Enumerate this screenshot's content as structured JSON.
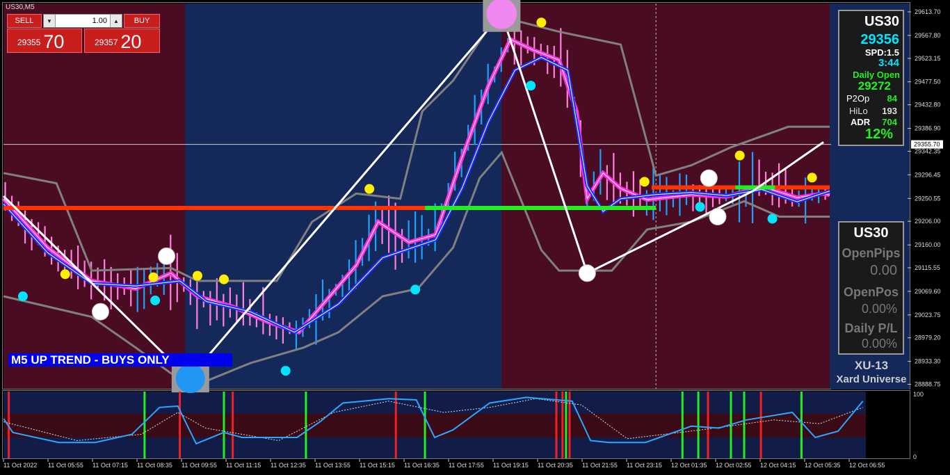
{
  "window": {
    "symbol_label": "US30,M5"
  },
  "trade_panel": {
    "sell_label": "SELL",
    "buy_label": "BUY",
    "lot_value": "1.00",
    "bid_small": "29355",
    "bid_big": "70",
    "ask_small": "29357",
    "ask_big": "20"
  },
  "info_box": {
    "symbol": "US30",
    "price": "29356",
    "spread": "SPD:1.5",
    "timer": "3:44",
    "daily_open_label": "Daily Open",
    "daily_open": "29272",
    "p2op_label": "P2Op",
    "p2op": "84",
    "hilo_label": "HiLo",
    "hilo": "193",
    "adr_label": "ADR",
    "adr": "704",
    "adr_pct": "12%"
  },
  "stats_box": {
    "symbol": "US30",
    "open_pips_label": "OpenPips",
    "open_pips": "0.00",
    "open_pos_label": "OpenPos",
    "open_pos": "0.00%",
    "daily_pl_label": "Daily P/L",
    "daily_pl": "0.00%"
  },
  "branding": {
    "title": "XU-13",
    "subtitle": "Xard Universe"
  },
  "trend_label": "M5 UP TREND - BUYS ONLY",
  "colors": {
    "maroon_zone": "#4a0c22",
    "blue_zone": "#14295a",
    "zigzag": "#ffffff",
    "ma_fast": "#ff2fe0",
    "ma_slow": "#1a2cff",
    "channel": "#808080",
    "candle_up": "#1fa0ff",
    "candle_down": "#ff80e0",
    "dot_high": "#ffee00",
    "dot_low": "#00e5ff",
    "daily_open_line": "#ff3300",
    "daily_open_line_alt": "#22ee22",
    "oscillator": "#2aa8ff"
  },
  "chart_data": [
    {
      "type": "candlestick",
      "title": "US30,M5",
      "y_ticks": [
        "29613.70",
        "29567.80",
        "29523.15",
        "29477.50",
        "29432.80",
        "29386.90",
        "29342.35",
        "29296.45",
        "29250.55",
        "29206.00",
        "29160.00",
        "29115.55",
        "29069.60",
        "29023.75",
        "28979.20",
        "28933.30",
        "28888.75"
      ],
      "current_price_label": "29355.70",
      "x_ticks": [
        "11 Oct 2022",
        "11 Oct 05:55",
        "11 Oct 07:15",
        "11 Oct 08:35",
        "11 Oct 09:55",
        "11 Oct 11:15",
        "11 Oct 12:35",
        "11 Oct 13:55",
        "11 Oct 15:15",
        "11 Oct 16:35",
        "11 Oct 17:55",
        "11 Oct 19:15",
        "11 Oct 20:35",
        "11 Oct 21:55",
        "11 Oct 23:15",
        "12 Oct 01:35",
        "12 Oct 02:55",
        "12 Oct 04:15",
        "12 Oct 05:35",
        "12 Oct 06:55"
      ],
      "ylim": [
        28880,
        29630
      ],
      "current_price": 29355.7,
      "daily_open": 29272,
      "zones": [
        {
          "from": 0,
          "to": 2.06,
          "trend": "down"
        },
        {
          "from": 2.06,
          "to": 5.65,
          "trend": "up"
        },
        {
          "from": 5.65,
          "to": 9.37,
          "trend": "down"
        },
        {
          "from": 9.37,
          "to": 9.75,
          "trend": "up"
        }
      ],
      "zigzag": [
        [
          0,
          29255
        ],
        [
          2.1,
          28900
        ],
        [
          5.65,
          29610
        ],
        [
          6.62,
          29105
        ],
        [
          8.5,
          29265
        ],
        [
          9.3,
          29360
        ]
      ],
      "swing_high_markers": [
        [
          1.85,
          29138
        ],
        [
          8.0,
          29290
        ],
        [
          5.65,
          29610
        ]
      ],
      "swing_low_markers": [
        [
          1.1,
          29030
        ],
        [
          2.12,
          28900
        ],
        [
          6.62,
          29105
        ],
        [
          8.1,
          29215
        ]
      ],
      "high_dots": [
        [
          0.7,
          29103
        ],
        [
          1.7,
          29097
        ],
        [
          2.2,
          29100
        ],
        [
          2.5,
          29093
        ],
        [
          4.15,
          29269
        ],
        [
          6.1,
          29593
        ],
        [
          7.27,
          29283
        ],
        [
          8.35,
          29334
        ],
        [
          9.17,
          29291
        ]
      ],
      "low_dots": [
        [
          0.22,
          29060
        ],
        [
          1.72,
          29052
        ],
        [
          3.2,
          28915
        ],
        [
          4.67,
          29073
        ],
        [
          5.98,
          29470
        ],
        [
          7.9,
          29234
        ],
        [
          8.72,
          29211
        ]
      ],
      "ma_fast": [
        [
          0,
          29250
        ],
        [
          0.5,
          29155
        ],
        [
          1.0,
          29090
        ],
        [
          1.5,
          29075
        ],
        [
          1.9,
          29105
        ],
        [
          2.2,
          29060
        ],
        [
          2.6,
          29040
        ],
        [
          3.0,
          29010
        ],
        [
          3.35,
          28990
        ],
        [
          3.7,
          29060
        ],
        [
          4.0,
          29120
        ],
        [
          4.25,
          29205
        ],
        [
          4.6,
          29165
        ],
        [
          4.9,
          29180
        ],
        [
          5.2,
          29330
        ],
        [
          5.5,
          29470
        ],
        [
          5.75,
          29560
        ],
        [
          6.0,
          29540
        ],
        [
          6.3,
          29520
        ],
        [
          6.5,
          29420
        ],
        [
          6.62,
          29250
        ],
        [
          6.8,
          29300
        ],
        [
          7.0,
          29270
        ],
        [
          7.3,
          29248
        ],
        [
          7.8,
          29258
        ],
        [
          8.2,
          29254
        ],
        [
          8.6,
          29274
        ],
        [
          9.0,
          29252
        ],
        [
          9.3,
          29260
        ],
        [
          9.37,
          29257
        ]
      ],
      "ma_slow": [
        [
          0,
          29240
        ],
        [
          0.5,
          29145
        ],
        [
          1.0,
          29085
        ],
        [
          1.5,
          29080
        ],
        [
          2.0,
          29090
        ],
        [
          2.3,
          29050
        ],
        [
          2.8,
          29030
        ],
        [
          3.3,
          28990
        ],
        [
          3.8,
          29045
        ],
        [
          4.3,
          29135
        ],
        [
          4.9,
          29170
        ],
        [
          5.2,
          29270
        ],
        [
          5.5,
          29400
        ],
        [
          5.8,
          29500
        ],
        [
          6.1,
          29525
        ],
        [
          6.4,
          29500
        ],
        [
          6.62,
          29275
        ],
        [
          6.8,
          29225
        ],
        [
          7.0,
          29250
        ],
        [
          7.4,
          29258
        ],
        [
          7.8,
          29262
        ],
        [
          8.2,
          29256
        ],
        [
          8.6,
          29268
        ],
        [
          9.0,
          29244
        ],
        [
          9.37,
          29265
        ]
      ],
      "channel_upper": [
        [
          0,
          29300
        ],
        [
          0.6,
          29280
        ],
        [
          1.0,
          29110
        ],
        [
          1.9,
          29115
        ],
        [
          2.2,
          29090
        ],
        [
          3.1,
          29090
        ],
        [
          3.5,
          29205
        ],
        [
          4.0,
          29260
        ],
        [
          4.5,
          29250
        ],
        [
          4.75,
          29420
        ],
        [
          5.1,
          29480
        ],
        [
          5.55,
          29595
        ],
        [
          5.62,
          29605
        ],
        [
          6.3,
          29575
        ],
        [
          7.0,
          29550
        ],
        [
          7.4,
          29295
        ],
        [
          7.8,
          29315
        ],
        [
          8.25,
          29350
        ],
        [
          8.9,
          29390
        ],
        [
          9.37,
          29390
        ]
      ],
      "channel_lower": [
        [
          0,
          29060
        ],
        [
          1.0,
          29020
        ],
        [
          1.5,
          28960
        ],
        [
          1.9,
          28910
        ],
        [
          2.3,
          28895
        ],
        [
          2.8,
          28930
        ],
        [
          3.4,
          28960
        ],
        [
          3.8,
          28990
        ],
        [
          4.3,
          29060
        ],
        [
          4.7,
          29075
        ],
        [
          5.1,
          29155
        ],
        [
          5.4,
          29290
        ],
        [
          5.65,
          29340
        ],
        [
          6.1,
          29150
        ],
        [
          6.3,
          29110
        ],
        [
          6.9,
          29110
        ],
        [
          7.3,
          29190
        ],
        [
          7.8,
          29205
        ],
        [
          8.4,
          29245
        ],
        [
          8.8,
          29215
        ],
        [
          9.37,
          29215
        ]
      ]
    },
    {
      "type": "line",
      "title": "",
      "y_ticks": [
        "100",
        "0"
      ],
      "ylim": [
        0,
        100
      ],
      "series": [
        {
          "name": "",
          "values": [
            [
              0,
              60
            ],
            [
              0.1,
              38
            ],
            [
              0.6,
              22
            ],
            [
              1.0,
              22
            ],
            [
              1.4,
              35
            ],
            [
              1.7,
              78
            ],
            [
              1.9,
              80
            ],
            [
              2.1,
              20
            ],
            [
              2.4,
              38
            ],
            [
              2.6,
              30
            ],
            [
              3.2,
              30
            ],
            [
              3.45,
              55
            ],
            [
              3.7,
              85
            ],
            [
              4.2,
              92
            ],
            [
              4.5,
              90
            ],
            [
              4.7,
              30
            ],
            [
              4.9,
              42
            ],
            [
              5.3,
              85
            ],
            [
              5.7,
              94
            ],
            [
              6.2,
              88
            ],
            [
              6.4,
              25
            ],
            [
              6.6,
              22
            ],
            [
              7.0,
              22
            ],
            [
              7.5,
              48
            ],
            [
              7.8,
              45
            ],
            [
              8.1,
              58
            ],
            [
              8.6,
              70
            ],
            [
              8.85,
              30
            ],
            [
              9.1,
              40
            ],
            [
              9.37,
              88
            ]
          ]
        },
        {
          "name": "",
          "values": [
            [
              0,
              55
            ],
            [
              0.8,
              25
            ],
            [
              1.5,
              35
            ],
            [
              1.9,
              70
            ],
            [
              2.2,
              45
            ],
            [
              3.0,
              25
            ],
            [
              3.6,
              70
            ],
            [
              4.2,
              88
            ],
            [
              4.8,
              70
            ],
            [
              5.3,
              78
            ],
            [
              5.8,
              92
            ],
            [
              6.3,
              82
            ],
            [
              6.8,
              28
            ],
            [
              7.6,
              42
            ],
            [
              8.4,
              58
            ],
            [
              8.9,
              52
            ],
            [
              9.37,
              78
            ]
          ]
        }
      ],
      "signals_green": [
        1.6,
        2.5,
        3.43,
        4.78,
        6.38,
        7.7,
        7.88,
        8.25,
        8.4,
        9.05
      ],
      "signals_red": [
        0.06,
        2.0,
        2.6,
        4.45,
        6.27,
        6.34,
        6.42,
        7.99,
        8.59
      ]
    }
  ]
}
